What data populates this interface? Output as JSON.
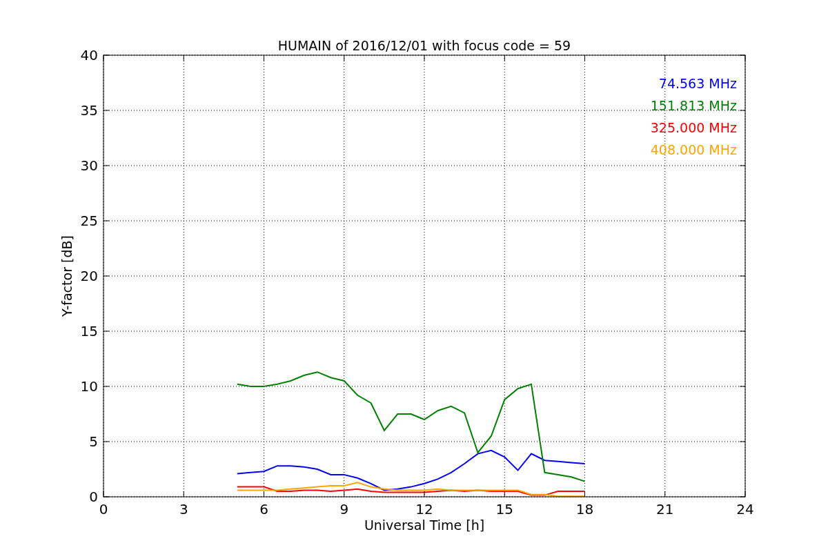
{
  "chart_data": {
    "type": "line",
    "title": "HUMAIN of 2016/12/01 with focus code = 59",
    "xlabel": "Universal Time [h]",
    "ylabel": "Y-factor [dB]",
    "x": [
      5,
      5.5,
      6,
      6.5,
      7,
      7.5,
      8,
      8.5,
      9,
      9.5,
      10,
      10.5,
      11,
      11.5,
      12,
      12.5,
      13,
      13.5,
      14,
      14.5,
      15,
      15.5,
      16,
      16.5,
      17,
      17.5,
      18
    ],
    "series": [
      {
        "name": "74.563 MHz",
        "color": "#0000ff",
        "values": [
          2.1,
          2.2,
          2.3,
          2.8,
          2.8,
          2.7,
          2.5,
          2.0,
          2.0,
          1.7,
          1.2,
          0.6,
          0.7,
          0.9,
          1.2,
          1.6,
          2.2,
          3.0,
          3.9,
          4.2,
          3.6,
          2.4,
          3.9,
          3.3,
          3.2,
          3.1,
          3.0
        ]
      },
      {
        "name": "151.813 MHz",
        "color": "#008000",
        "values": [
          10.2,
          10.0,
          10.0,
          10.2,
          10.5,
          11.0,
          11.3,
          10.8,
          10.5,
          9.2,
          8.5,
          6.0,
          7.5,
          7.5,
          7.0,
          7.8,
          8.2,
          7.6,
          4.0,
          5.5,
          8.8,
          9.8,
          10.2,
          2.2,
          2.0,
          1.8,
          1.4
        ]
      },
      {
        "name": "325.000 MHz",
        "color": "#ff0000",
        "values": [
          0.9,
          0.9,
          0.9,
          0.5,
          0.5,
          0.6,
          0.6,
          0.5,
          0.6,
          0.7,
          0.5,
          0.4,
          0.4,
          0.4,
          0.4,
          0.5,
          0.6,
          0.5,
          0.6,
          0.5,
          0.5,
          0.5,
          0.15,
          0.15,
          0.5,
          0.5,
          0.5
        ]
      },
      {
        "name": "408.000 MHz",
        "color": "#ffa500",
        "values": [
          0.6,
          0.6,
          0.6,
          0.6,
          0.7,
          0.8,
          0.9,
          1.0,
          1.0,
          1.3,
          0.9,
          0.7,
          0.6,
          0.6,
          0.6,
          0.7,
          0.6,
          0.6,
          0.6,
          0.6,
          0.6,
          0.6,
          0.2,
          0.2,
          0.05,
          0.05,
          0.05
        ]
      }
    ],
    "grid": true,
    "xlim": [
      0,
      24
    ],
    "ylim": [
      0,
      40
    ],
    "xticks": [
      0,
      3,
      6,
      9,
      12,
      15,
      18,
      21,
      24
    ],
    "yticks": [
      0,
      5,
      10,
      15,
      20,
      25,
      30,
      35,
      40
    ]
  }
}
